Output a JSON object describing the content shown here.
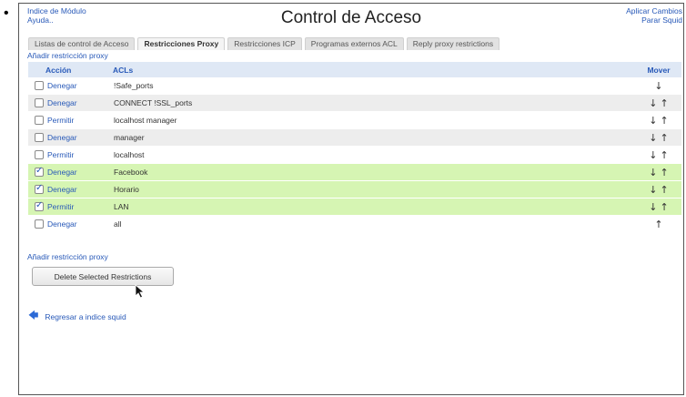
{
  "page": {
    "bullet": "•",
    "title": "Control de Acceso"
  },
  "header": {
    "module_index": "Indice de Módulo",
    "help": "Ayuda..",
    "apply_changes": "Aplicar Cambios",
    "stop_squid": "Parar Squid"
  },
  "tabs": [
    {
      "label": "Listas de control de Acceso",
      "active": false
    },
    {
      "label": "Restricciones Proxy",
      "active": true
    },
    {
      "label": "Restricciones ICP",
      "active": false
    },
    {
      "label": "Programas externos ACL",
      "active": false
    },
    {
      "label": "Reply proxy restrictions",
      "active": false
    }
  ],
  "add_restriction_label": "Añadir restricción proxy",
  "table": {
    "columns": {
      "action": "Acción",
      "acls": "ACLs",
      "move": "Mover"
    },
    "rows": [
      {
        "checked": false,
        "action": "Denegar",
        "acl": "!Safe_ports",
        "move": [
          "↓"
        ]
      },
      {
        "checked": false,
        "action": "Denegar",
        "acl": "CONNECT !SSL_ports",
        "move": [
          "↓",
          "↑"
        ]
      },
      {
        "checked": false,
        "action": "Permitir",
        "acl": "localhost manager",
        "move": [
          "↓",
          "↑"
        ]
      },
      {
        "checked": false,
        "action": "Denegar",
        "acl": "manager",
        "move": [
          "↓",
          "↑"
        ]
      },
      {
        "checked": false,
        "action": "Permitir",
        "acl": "localhost",
        "move": [
          "↓",
          "↑"
        ]
      },
      {
        "checked": true,
        "action": "Denegar",
        "acl": "Facebook",
        "move": [
          "↓",
          "↑"
        ]
      },
      {
        "checked": true,
        "action": "Denegar",
        "acl": "Horario",
        "move": [
          "↓",
          "↑"
        ]
      },
      {
        "checked": true,
        "action": "Permitir",
        "acl": "LAN",
        "move": [
          "↓",
          "↑"
        ]
      },
      {
        "checked": false,
        "action": "Denegar",
        "acl": "all",
        "move": [
          "↑"
        ]
      }
    ]
  },
  "delete_button": "Delete Selected Restrictions",
  "back_link": "Regresar a indice squid",
  "icons": {
    "back": "back-arrow-icon",
    "cursor": "mouse-pointer-icon"
  },
  "colors": {
    "link": "#2859b8",
    "header_bg": "#dfe8f5",
    "selected_row": "#d6f5b3",
    "alt_row": "#ededed"
  }
}
